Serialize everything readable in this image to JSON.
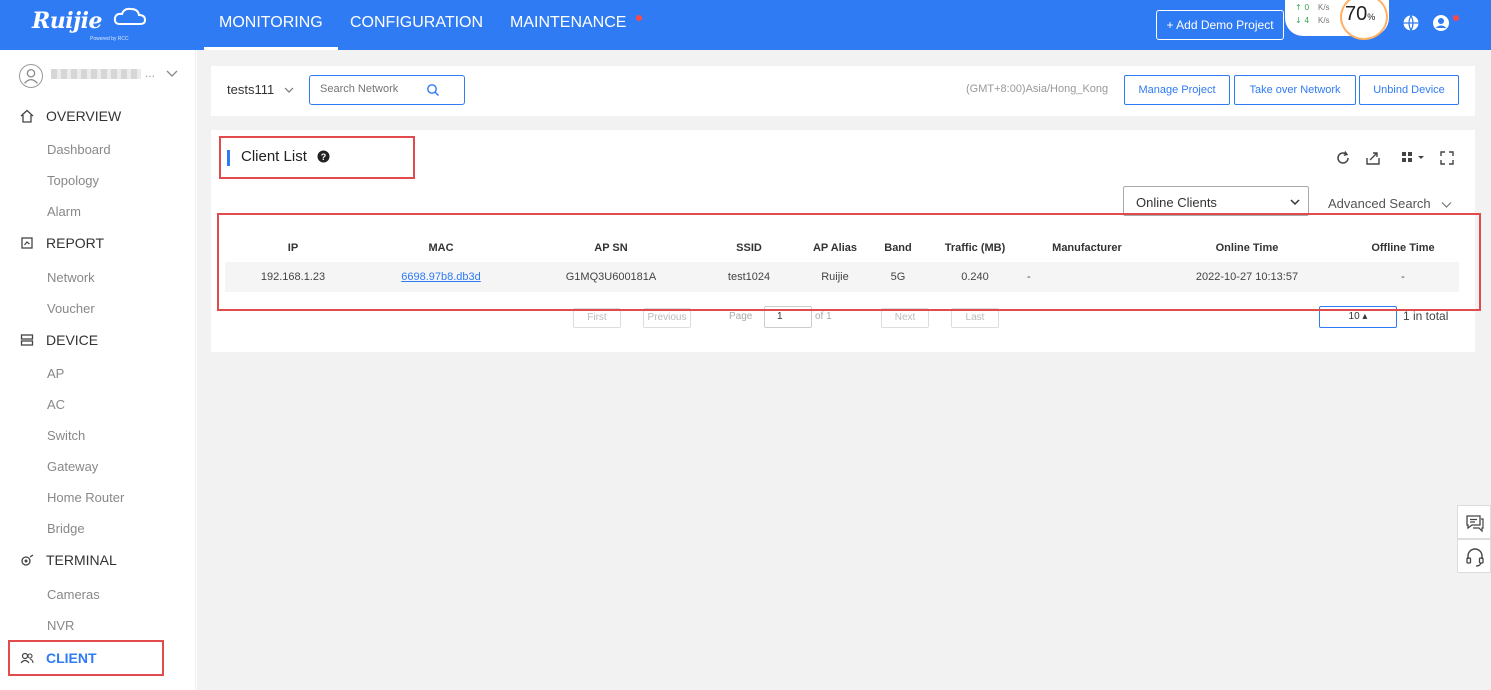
{
  "brand": {
    "name": "Ruijie",
    "tagline": "Powered by RCC"
  },
  "nav": [
    {
      "label": "MONITORING",
      "active": true
    },
    {
      "label": "CONFIGURATION",
      "active": false
    },
    {
      "label": "MAINTENANCE",
      "active": false,
      "badge": true
    }
  ],
  "header": {
    "add_demo_label": "+ Add Demo Project",
    "upload_speed": "0",
    "download_speed": "4",
    "speed_unit": "K/s",
    "gauge_value": "70",
    "gauge_unit": "%"
  },
  "sidebar": {
    "account_ellipsis": "...",
    "sections": [
      {
        "label": "OVERVIEW",
        "icon": "home-icon",
        "items": [
          "Dashboard",
          "Topology",
          "Alarm"
        ]
      },
      {
        "label": "REPORT",
        "icon": "report-icon",
        "items": [
          "Network",
          "Voucher"
        ]
      },
      {
        "label": "DEVICE",
        "icon": "device-icon",
        "items": [
          "AP",
          "AC",
          "Switch",
          "Gateway",
          "Home Router",
          "Bridge"
        ]
      },
      {
        "label": "TERMINAL",
        "icon": "terminal-icon",
        "items": [
          "Cameras",
          "NVR"
        ]
      }
    ],
    "client_label": "CLIENT"
  },
  "project": {
    "name": "tests111",
    "search_placeholder": "Search Network",
    "timezone": "(GMT+8:00)Asia/Hong_Kong",
    "manage_label": "Manage Project",
    "takeover_label": "Take over Network",
    "unbind_label": "Unbind Device"
  },
  "panel": {
    "title": "Client List",
    "filter_selected": "Online Clients",
    "advanced_search": "Advanced Search"
  },
  "table": {
    "columns": [
      "IP",
      "MAC",
      "AP SN",
      "SSID",
      "AP Alias",
      "Band",
      "Traffic (MB)",
      "Manufacturer",
      "Online Time",
      "Offline Time"
    ],
    "rows": [
      [
        "192.168.1.23",
        "6698.97b8.db3d",
        "G1MQ3U600181A",
        "test1024",
        "Ruijie",
        "5G",
        "0.240",
        "-",
        "2022-10-27 10:13:57",
        "-"
      ]
    ]
  },
  "pagination": {
    "first": "First",
    "previous": "Previous",
    "page_label": "Page",
    "page_value": "1",
    "of_label": "of 1",
    "next": "Next",
    "last": "Last",
    "page_size": "10 ▴",
    "total": "1 in total"
  },
  "colors": {
    "primary": "#2f7bf4",
    "highlight": "#e14b4b"
  }
}
